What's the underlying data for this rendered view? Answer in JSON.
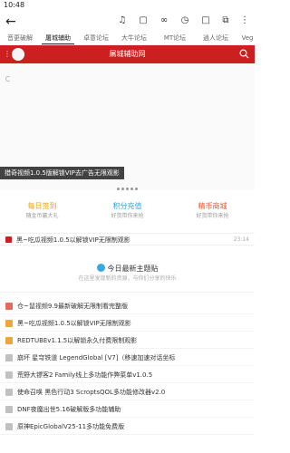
{
  "status": {
    "time": "10:48"
  },
  "toolbar": {
    "back_icon": "back-arrow-icon",
    "icons": [
      "music-note-icon",
      "edit-square-icon",
      "link-icon",
      "history-icon",
      "bookmark-icon",
      "copy-icon",
      "more-vert-icon"
    ]
  },
  "tabs": [
    {
      "label": "音更破解"
    },
    {
      "label": "屠城辅助",
      "active": true
    },
    {
      "label": "卓意论坛"
    },
    {
      "label": "大牛论坛"
    },
    {
      "label": "MT论坛"
    },
    {
      "label": "逍人论坛"
    },
    {
      "label": "Veg"
    }
  ],
  "header": {
    "title": "屠城辅助网",
    "color": "#cc1f1f"
  },
  "banner": {
    "caption": "猎奇视频1.0.5版解锁VIP去广告无限观影"
  },
  "quick": [
    {
      "title": "每日签到",
      "sub": "随金币赢大礼",
      "color": "#e8a01a"
    },
    {
      "title": "积分充值",
      "sub": "好货带你来抢",
      "color": "#2fa4d8"
    },
    {
      "title": "精币商城",
      "sub": "好货带你来抢",
      "color": "#e5572e"
    }
  ],
  "notice": {
    "text": "黑~吃瓜视频1.0.5以解锁VIP无限制观影",
    "time": "23:14"
  },
  "section": {
    "title": "今日最新主题贴",
    "sub": "在这里发现新的资源，与你们分享的快乐"
  },
  "list": [
    {
      "text": "仓~鼠视频9.9最新破解无限制看完整版",
      "color": "#e56a5c"
    },
    {
      "text": "黑~吃瓜视频1.0.5以解锁VIP无限制观影",
      "color": "#f0a43a"
    },
    {
      "text": "REDTUBEv1.1.5以解锁永久付费限制观影",
      "color": "#f0a43a"
    },
    {
      "text": "崩坏 星穹铁道 LegendGlobal [V7]（移速加速对话坐标",
      "color": "#c0c0c0"
    },
    {
      "text": "荒野大镖客2 Family线上多功能作弊菜单v1.0.5",
      "color": "#c0c0c0"
    },
    {
      "text": "使命召唤 黑色行动3 ScroptsQOL多功能修改器v2.0",
      "color": "#c0c0c0"
    },
    {
      "text": "DNF夜魔出世5.16破解版多功能辅助",
      "color": "#c0c0c0"
    },
    {
      "text": "原神EpicGlobalV25-11多功能免费版",
      "color": "#c0c0c0"
    }
  ]
}
